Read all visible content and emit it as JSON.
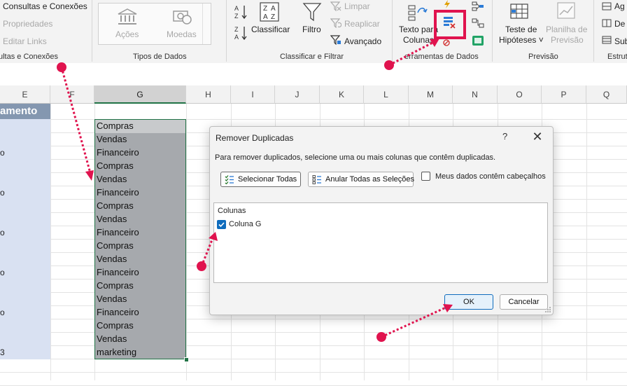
{
  "ribbon": {
    "get_data": {
      "items": [
        "Consultas e Conexões",
        "Propriedades",
        "Editar Links"
      ],
      "group_label": "ultas e Conexões"
    },
    "data_types": {
      "items": [
        "Ações",
        "Moedas"
      ],
      "group_label": "Tipos de Dados"
    },
    "sort_filter": {
      "sort_label": "Classificar",
      "filter_label": "Filtro",
      "clear_label": "Limpar",
      "reapply_label": "Reaplicar",
      "advanced_label": "Avançado",
      "group_label": "Classificar e Filtrar"
    },
    "data_tools": {
      "text_to_columns_line1": "Texto para",
      "text_to_columns_line2": "Colunas",
      "group_label": "erramentas de Dados"
    },
    "forecast": {
      "what_if_line1": "Teste de",
      "what_if_line2": "Hipóteses",
      "forecast_sheet_line1": "Planilha de",
      "forecast_sheet_line2": "Previsão",
      "group_label": "Previsão"
    },
    "outline": {
      "items": [
        "Ag",
        "De",
        "Sub"
      ],
      "group_label": "Estrutu"
    }
  },
  "sheet": {
    "columns": [
      "E",
      "F",
      "G",
      "H",
      "I",
      "J",
      "K",
      "L",
      "M",
      "N",
      "O",
      "P",
      "Q"
    ],
    "selected_column": "G",
    "col_e_header": "amento",
    "col_e_values": [
      "o",
      "o",
      "o",
      "o",
      "o",
      "3"
    ],
    "col_g_values": [
      "Compras",
      "Vendas",
      "Financeiro",
      "Compras",
      "Vendas",
      "Financeiro",
      "Compras",
      "Vendas",
      "Financeiro",
      "Compras",
      "Vendas",
      "Financeiro",
      "Compras",
      "Vendas",
      "Financeiro",
      "Compras",
      "Vendas",
      "marketing"
    ]
  },
  "dialog": {
    "title": "Remover Duplicadas",
    "help": "?",
    "close": "✕",
    "description": "Para remover duplicados, selecione uma ou mais colunas que contêm duplicadas.",
    "select_all_label": "Selecionar Todas",
    "unselect_all_label": "Anular Todas as Seleções",
    "headers_checkbox_label": "Meus dados contêm cabeçalhos",
    "headers_checked": false,
    "columns_title": "Colunas",
    "columns": [
      {
        "label": "Coluna G",
        "checked": true
      }
    ],
    "ok_label": "OK",
    "cancel_label": "Cancelar"
  },
  "colors": {
    "annotation": "#e0134e",
    "selection_border": "#217346",
    "header_fill": "#8497b0",
    "column_e_fill": "#d9e1f2",
    "checkbox_blue": "#0f6cbd"
  }
}
